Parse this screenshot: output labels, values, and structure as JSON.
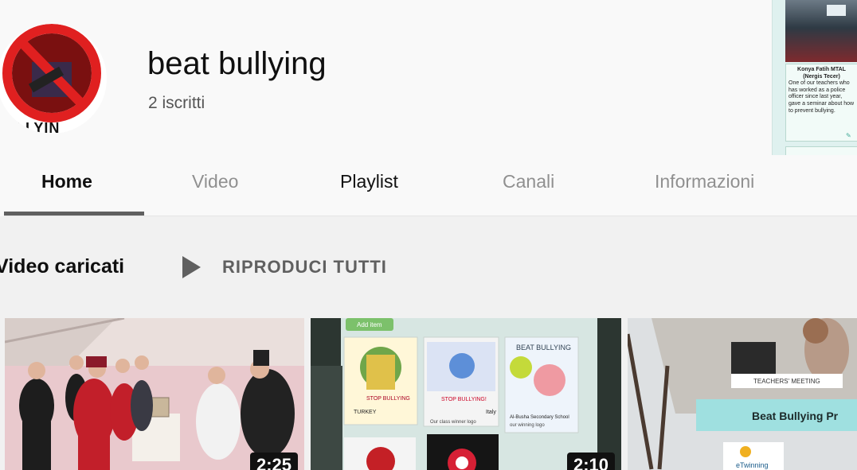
{
  "channel": {
    "avatar_text": "ILLYIN",
    "name": "beat bullying",
    "subscribers": "2 iscritti"
  },
  "side_card": {
    "title": "Konya Fatih MTAL (Nergis Tecer)",
    "body": "One of our teachers who has worked as a police officer since last year, gave a seminar about how to prevent bullying."
  },
  "tabs": [
    "Home",
    "Video",
    "Playlist",
    "Canali",
    "Informazioni"
  ],
  "section": {
    "title": "Video caricati",
    "play_all": "RIPRODUCI TUTTI"
  },
  "thumbnails": [
    {
      "duration": "2:25"
    },
    {
      "duration": "2:10",
      "add_item": "Add item",
      "panel_title": "BEAT BULLYING",
      "card1": "TURKEY",
      "card2": "Italy",
      "card2b": "Our class winner logo",
      "card3": "Al-Busha Secondary School",
      "card3b": "our winning logo",
      "stop": "STOP BULLYING",
      "stop2": "STOP BULLYING!"
    },
    {
      "label": "TEACHERS' MEETING",
      "title": "Beat Bullying Pr",
      "brand": "eTwinning"
    }
  ]
}
